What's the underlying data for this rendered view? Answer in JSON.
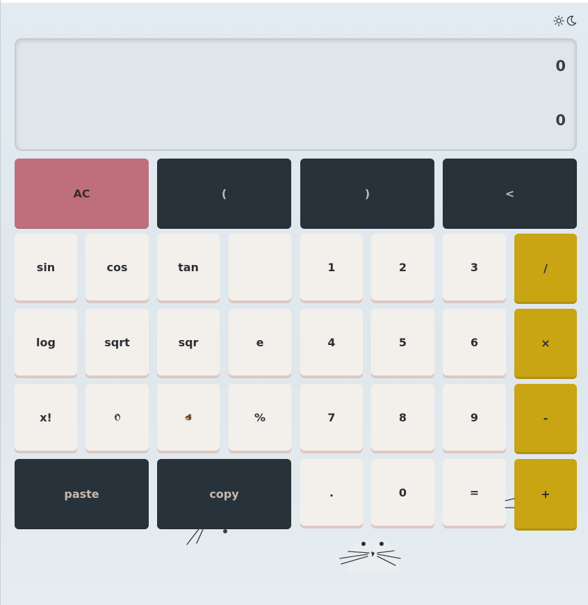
{
  "theme_toggle": {
    "sun_icon": "sun-icon",
    "moon_icon": "moon-icon"
  },
  "display": {
    "expression": "0",
    "result": "0"
  },
  "top_row": {
    "clear": "AC",
    "open_paren": "(",
    "close_paren": ")",
    "backspace": "<"
  },
  "functions": {
    "sin": "sin",
    "cos": "cos",
    "tan": "tan",
    "log": "log",
    "sqrt": "sqrt",
    "sqr": "sqr",
    "e": "e",
    "factorial": "x!",
    "percent": "%"
  },
  "digits": {
    "d1": "1",
    "d2": "2",
    "d3": "3",
    "d4": "4",
    "d5": "5",
    "d6": "6",
    "d7": "7",
    "d8": "8",
    "d9": "9",
    "d0": "0",
    "dot": "."
  },
  "operators": {
    "divide": "/",
    "multiply": "×",
    "minus": "-",
    "plus": "+",
    "equals": "="
  },
  "clipboard": {
    "paste": "paste",
    "copy": "copy"
  },
  "colors": {
    "pink": "#bf6f7b",
    "dark": "#27323a",
    "gold": "#c9a413",
    "light": "#f3f0ec",
    "display": "#dfe6ea"
  }
}
